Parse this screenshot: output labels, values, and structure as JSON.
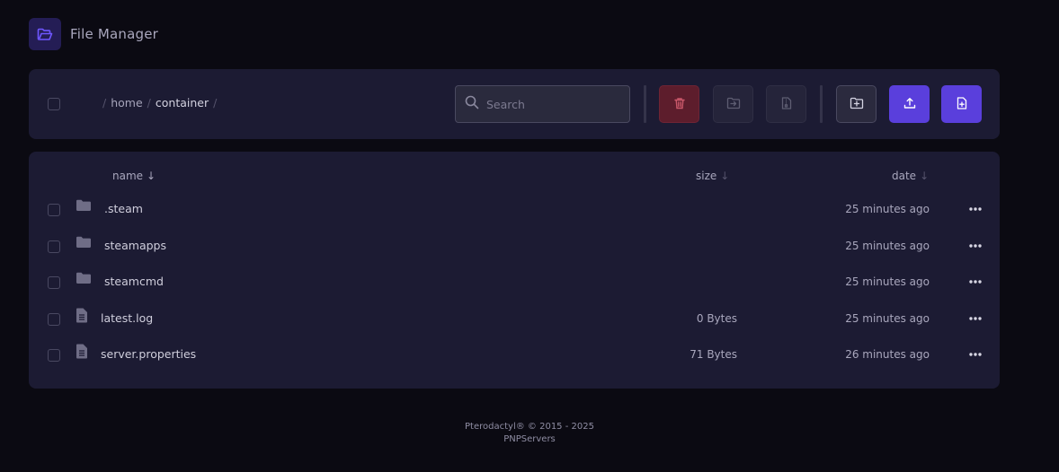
{
  "header": {
    "title": "File Manager",
    "icon": "folder-open-icon"
  },
  "toolbar": {
    "breadcrumb": [
      "home",
      "container"
    ],
    "search_placeholder": "Search",
    "buttons": [
      {
        "name": "delete",
        "icon": "trash-icon"
      },
      {
        "name": "move",
        "icon": "folder-move-icon"
      },
      {
        "name": "archive",
        "icon": "file-archive-icon"
      },
      {
        "name": "new-folder",
        "icon": "folder-plus-icon"
      },
      {
        "name": "upload",
        "icon": "upload-icon"
      },
      {
        "name": "new-file",
        "icon": "file-plus-icon"
      }
    ]
  },
  "table": {
    "columns": {
      "name": "name",
      "size": "size",
      "date": "date"
    },
    "rows": [
      {
        "name": ".steam",
        "type": "folder",
        "size": "",
        "date": "25 minutes ago"
      },
      {
        "name": "steamapps",
        "type": "folder",
        "size": "",
        "date": "25 minutes ago"
      },
      {
        "name": "steamcmd",
        "type": "folder",
        "size": "",
        "date": "25 minutes ago"
      },
      {
        "name": "latest.log",
        "type": "file",
        "size": "0 Bytes",
        "date": "25 minutes ago"
      },
      {
        "name": "server.properties",
        "type": "file",
        "size": "71 Bytes",
        "date": "26 minutes ago"
      }
    ]
  },
  "footer": {
    "line1": "Pterodactyl® © 2015 - 2025",
    "line2": "PNPServers"
  },
  "colors": {
    "accent": "#5a3fdc",
    "danger": "#5d1d2c",
    "panel": "#1c1b33",
    "background": "#0b0a12"
  }
}
